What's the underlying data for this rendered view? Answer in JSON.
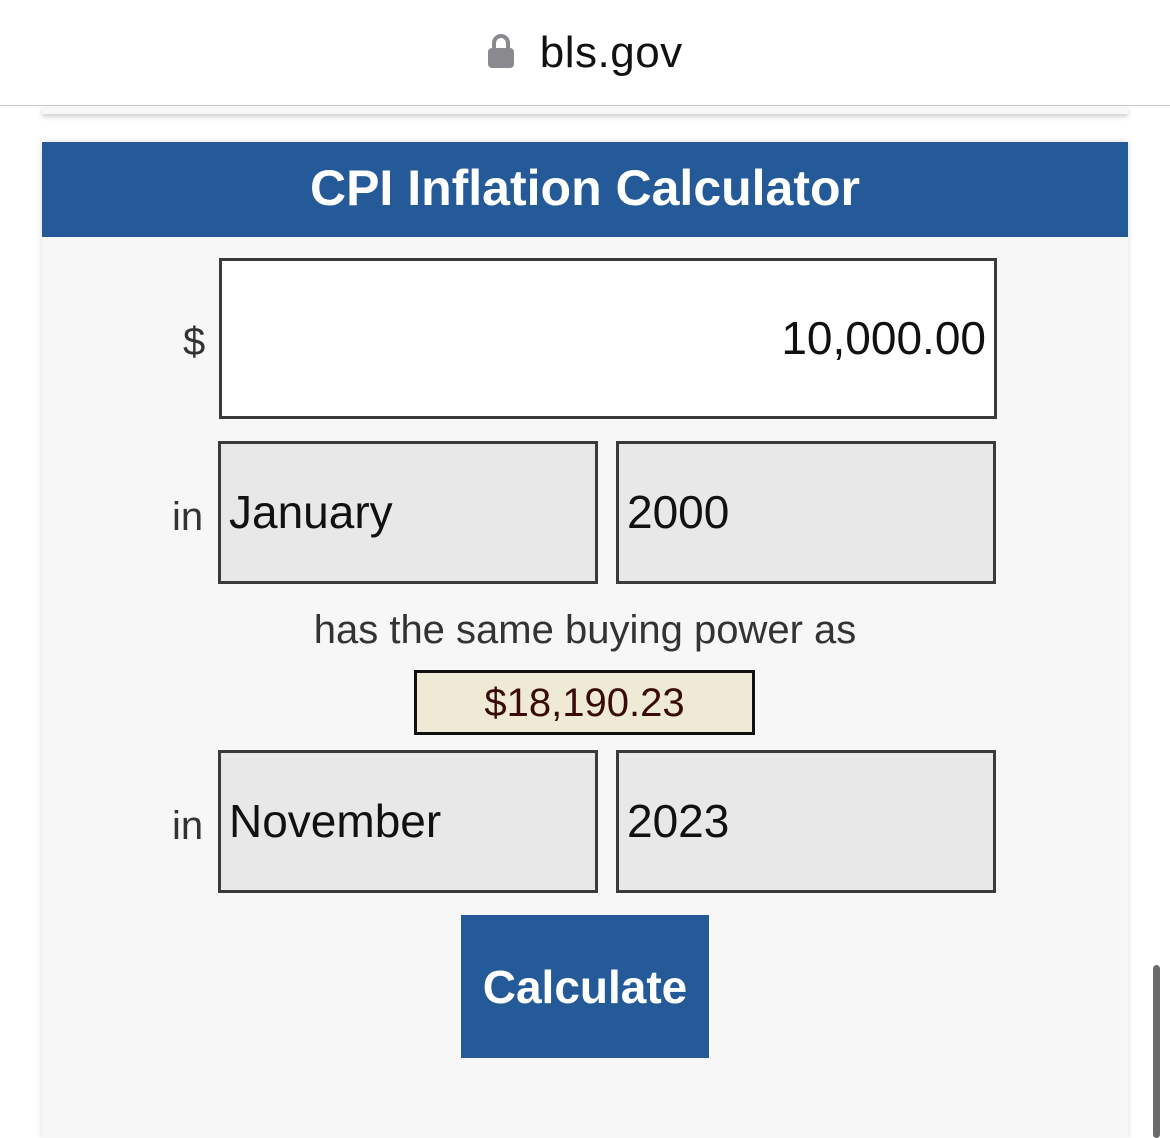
{
  "browser": {
    "url": "bls.gov",
    "lock_icon": "lock-icon"
  },
  "calculator": {
    "title": "CPI Inflation Calculator",
    "currency_symbol": "$",
    "amount": "10,000.00",
    "in_label": "in",
    "from_month": "January",
    "from_year": "2000",
    "same_power_text": "has the same buying power as",
    "result": "$18,190.23",
    "to_month": "November",
    "to_year": "2023",
    "calculate_label": "Calculate"
  },
  "colors": {
    "accent": "#255a99",
    "result_bg": "#eeead6",
    "result_text": "#3a0a0a"
  }
}
